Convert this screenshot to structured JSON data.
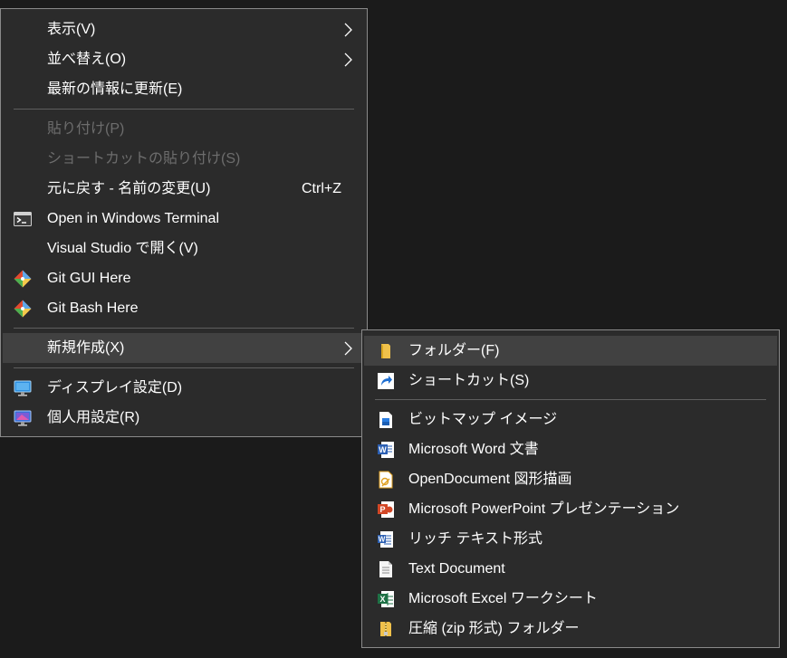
{
  "main_menu": {
    "items": [
      {
        "label": "表示(V)"
      },
      {
        "label": "並べ替え(O)"
      },
      {
        "label": "最新の情報に更新(E)"
      },
      {
        "label": "貼り付け(P)"
      },
      {
        "label": "ショートカットの貼り付け(S)"
      },
      {
        "label": "元に戻す - 名前の変更(U)",
        "shortcut": "Ctrl+Z"
      },
      {
        "label": "Open in Windows Terminal",
        "icon": "terminal-icon"
      },
      {
        "label": "Visual Studio で開く(V)"
      },
      {
        "label": "Git GUI Here",
        "icon": "git-icon"
      },
      {
        "label": "Git Bash Here",
        "icon": "git-icon"
      },
      {
        "label": "新規作成(X)"
      },
      {
        "label": "ディスプレイ設定(D)",
        "icon": "display-settings-icon"
      },
      {
        "label": "個人用設定(R)",
        "icon": "personalize-icon"
      }
    ]
  },
  "new_submenu": {
    "items": [
      {
        "label": "フォルダー(F)",
        "icon": "folder-icon"
      },
      {
        "label": "ショートカット(S)",
        "icon": "shortcut-icon"
      },
      {
        "label": "ビットマップ イメージ",
        "icon": "bitmap-icon"
      },
      {
        "label": "Microsoft Word 文書",
        "icon": "word-icon"
      },
      {
        "label": "OpenDocument 図形描画",
        "icon": "opendocument-drawing-icon"
      },
      {
        "label": "Microsoft PowerPoint プレゼンテーション",
        "icon": "powerpoint-icon"
      },
      {
        "label": "リッチ テキスト形式",
        "icon": "rich-text-icon"
      },
      {
        "label": "Text Document",
        "icon": "text-document-icon"
      },
      {
        "label": "Microsoft Excel ワークシート",
        "icon": "excel-icon"
      },
      {
        "label": "圧縮 (zip 形式) フォルダー",
        "icon": "zip-folder-icon"
      }
    ]
  },
  "colors": {
    "desktop_bg": "#1b1b1b",
    "menu_bg": "#2b2b2b",
    "highlight_bg": "#414141",
    "text": "#ffffff",
    "disabled_text": "#6d6d6d",
    "separator": "#5f5f5f"
  }
}
